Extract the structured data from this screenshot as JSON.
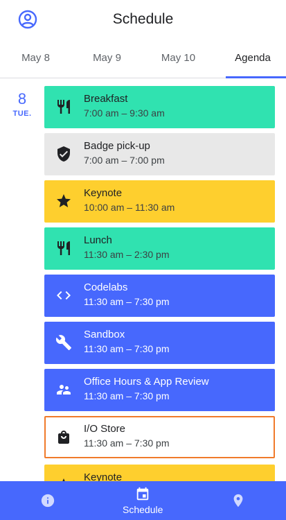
{
  "header": {
    "title": "Schedule",
    "account_icon": "account-circle-icon"
  },
  "tabs": [
    {
      "label": "May 8",
      "active": false
    },
    {
      "label": "May 9",
      "active": false
    },
    {
      "label": "May 10",
      "active": false
    },
    {
      "label": "Agenda",
      "active": true
    }
  ],
  "date": {
    "day": "8",
    "weekday": "TUE."
  },
  "events": [
    {
      "title": "Breakfast",
      "time": "7:00 am – 9:30 am",
      "icon": "restaurant-icon",
      "color": "#30e2b0"
    },
    {
      "title": "Badge pick-up",
      "time": "7:00 am – 7:00 pm",
      "icon": "verified-shield-icon",
      "color": "#e8e8e8"
    },
    {
      "title": "Keynote",
      "time": "10:00 am – 11:30 am",
      "icon": "star-icon",
      "color": "#fecf2e"
    },
    {
      "title": "Lunch",
      "time": "11:30 am – 2:30 pm",
      "icon": "restaurant-icon",
      "color": "#30e2b0"
    },
    {
      "title": "Codelabs",
      "time": "11:30 am – 7:30 pm",
      "icon": "code-icon",
      "color": "#4768fd"
    },
    {
      "title": "Sandbox",
      "time": "11:30 am – 7:30 pm",
      "icon": "wrench-icon",
      "color": "#4768fd"
    },
    {
      "title": "Office Hours & App Review",
      "time": "11:30 am – 7:30 pm",
      "icon": "people-icon",
      "color": "#4768fd"
    },
    {
      "title": "I/O Store",
      "time": "11:30 am – 7:30 pm",
      "icon": "shopping-bag-icon",
      "color": "#f07a2a"
    },
    {
      "title": "Keynote",
      "time": "",
      "icon": "star-icon",
      "color": "#fecf2e"
    }
  ],
  "bottom_nav": [
    {
      "label": "",
      "icon": "info-icon",
      "active": false
    },
    {
      "label": "Schedule",
      "icon": "calendar-icon",
      "active": true
    },
    {
      "label": "",
      "icon": "place-icon",
      "active": false
    }
  ]
}
